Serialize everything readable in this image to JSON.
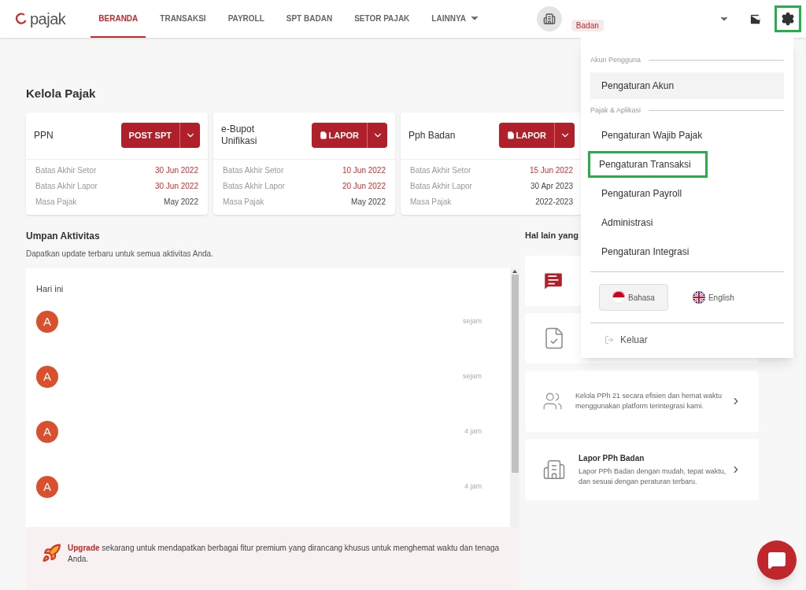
{
  "header": {
    "logo": "pajak",
    "nav": [
      {
        "label": "BERANDA",
        "selected": true,
        "kind": "link"
      },
      {
        "label": "TRANSAKSI",
        "selected": false,
        "kind": "link"
      },
      {
        "label": "PAYROLL",
        "selected": false,
        "kind": "link"
      },
      {
        "label": "SPT BADAN",
        "selected": false,
        "kind": "link"
      },
      {
        "label": "SETOR PAJAK",
        "selected": false,
        "kind": "link"
      },
      {
        "label": "LAINNYA",
        "selected": false,
        "kind": "menu"
      }
    ],
    "company_badge": "Badan",
    "settings_highlighted": true
  },
  "kelola": {
    "title": "Kelola Pajak",
    "cards": [
      {
        "name": "PPN",
        "action": "POST SPT",
        "action_icon": false,
        "rows": [
          {
            "label": "Batas Akhir Setor",
            "value": "30 Jun 2022",
            "overdue": true
          },
          {
            "label": "Batas Akhir Lapor",
            "value": "30 Jun 2022",
            "overdue": true
          },
          {
            "label": "Masa Pajak",
            "value": "May 2022",
            "overdue": false
          }
        ]
      },
      {
        "name": "e-Bupot Unifikasi",
        "action": "LAPOR",
        "action_icon": true,
        "rows": [
          {
            "label": "Batas Akhir Setor",
            "value": "10 Jun 2022",
            "overdue": true
          },
          {
            "label": "Batas Akhir Lapor",
            "value": "20 Jun 2022",
            "overdue": true
          },
          {
            "label": "Masa Pajak",
            "value": "May 2022",
            "overdue": false
          }
        ]
      },
      {
        "name": "Pph Badan",
        "action": "LAPOR",
        "action_icon": true,
        "rows": [
          {
            "label": "Batas Akhir Setor",
            "value": "15 Jun 2022",
            "overdue": true
          },
          {
            "label": "Batas Akhir Lapor",
            "value": "30 Apr 2023",
            "overdue": false
          },
          {
            "label": "Masa Pajak",
            "value": "2022-2023",
            "overdue": false
          }
        ]
      }
    ]
  },
  "activity": {
    "title": "Umpan Aktivitas",
    "subtitle": "Dapatkan update terbaru untuk semua aktivitas Anda.",
    "group": "Hari ini",
    "items": [
      {
        "initial": "A",
        "time": "sejam"
      },
      {
        "initial": "A",
        "time": "sejam"
      },
      {
        "initial": "A",
        "time": "4 jam"
      },
      {
        "initial": "A",
        "time": "4 jam"
      }
    ],
    "upgrade": "**Upgrade** sekarang untuk mendapatkan berbagai fitur premium yang dirancang khusus untuk menghemat waktu dan tenaga Anda."
  },
  "other": {
    "title": "Hal lain yang",
    "cards": [
      {
        "kind": "chat"
      },
      {
        "kind": "document"
      },
      {
        "kind": "people",
        "text": "Kelola PPh 21 secara efisien dan hemat waktu menggunakan platform terintegrasi kami."
      },
      {
        "kind": "building",
        "title": "Lapor PPh Badan",
        "text": "Lapor PPh Badan dengan mudah, tepat waktu, dan sesuai dengan peraturan terbaru."
      }
    ]
  },
  "settings_menu": {
    "sections": [
      {
        "label": "Akun Pengguna",
        "items": [
          {
            "label": "Pengaturan Akun",
            "selected": true,
            "highlighted": false
          }
        ]
      },
      {
        "label": "Pajak & Aplikasi",
        "items": [
          {
            "label": "Pengaturan Wajib Pajak",
            "selected": false,
            "highlighted": false
          },
          {
            "label": "Pengaturan Transaksi",
            "selected": false,
            "highlighted": true
          },
          {
            "label": "Pengaturan Payroll",
            "selected": false,
            "highlighted": false
          },
          {
            "label": "Administrasi",
            "selected": false,
            "highlighted": false
          },
          {
            "label": "Pengaturan Integrasi",
            "selected": false,
            "highlighted": false
          }
        ]
      }
    ],
    "languages": [
      {
        "label": "Bahasa",
        "kind": "id",
        "selected": true
      },
      {
        "label": "English",
        "kind": "uk",
        "selected": false
      }
    ],
    "logout": "Keluar"
  }
}
